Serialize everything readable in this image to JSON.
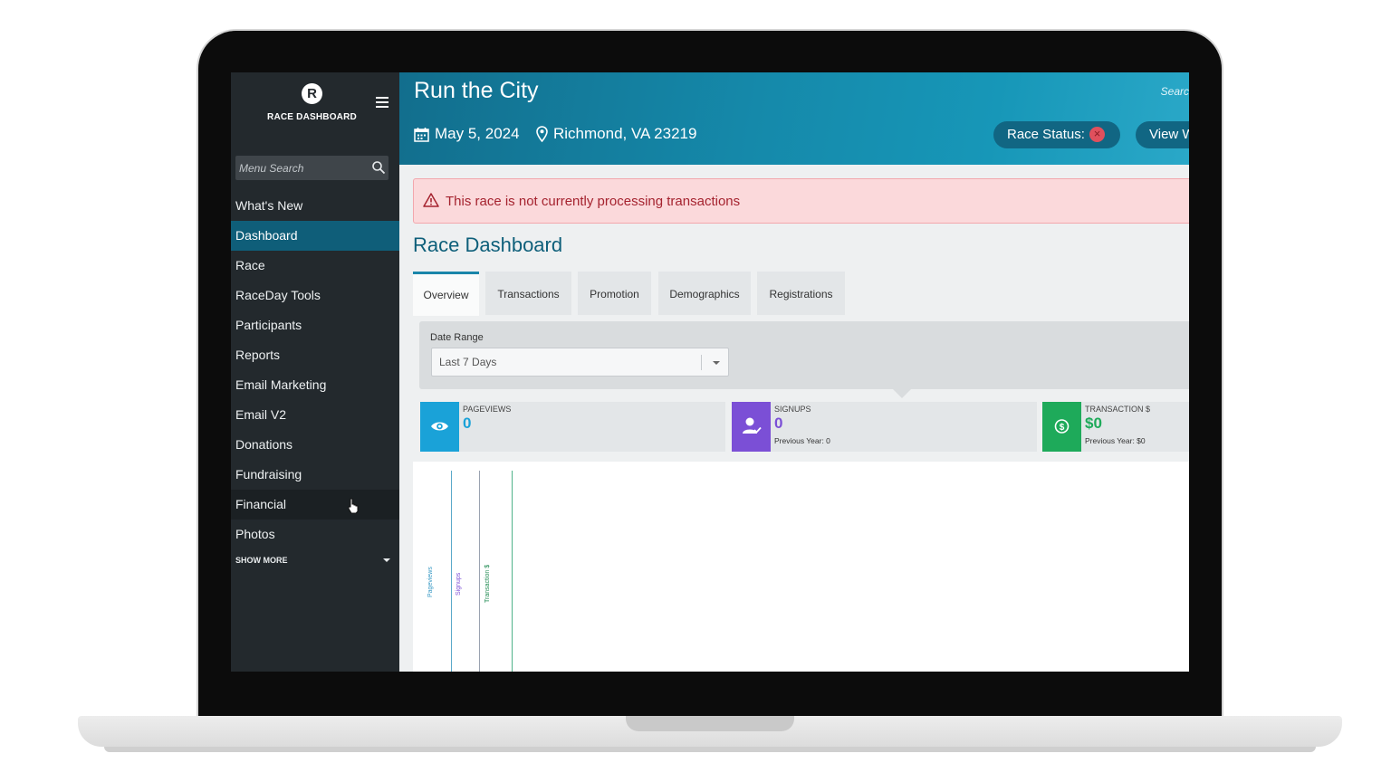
{
  "app": {
    "brand": "RACE DASHBOARD",
    "logo_letter": "R",
    "colors": {
      "accent": "#0f5e79",
      "sidebar": "#23292d",
      "header": "#1589aa",
      "alert_bg": "#fbd9db"
    }
  },
  "sidebar": {
    "search_placeholder": "Menu Search",
    "items": [
      {
        "label": "What's New"
      },
      {
        "label": "Dashboard",
        "active": true
      },
      {
        "label": "Race"
      },
      {
        "label": "RaceDay Tools"
      },
      {
        "label": "Participants"
      },
      {
        "label": "Reports"
      },
      {
        "label": "Email Marketing"
      },
      {
        "label": "Email V2"
      },
      {
        "label": "Donations"
      },
      {
        "label": "Fundraising"
      },
      {
        "label": "Financial",
        "hover": true
      },
      {
        "label": "Photos"
      }
    ],
    "show_more": "SHOW MORE"
  },
  "header": {
    "title": "Run the City",
    "search_hint": "Searc",
    "date": "May 5, 2024",
    "location": "Richmond, VA 23219",
    "race_status_label": "Race Status:",
    "view_label": "View W"
  },
  "alert": {
    "text": "This race is not currently processing transactions"
  },
  "main": {
    "title": "Race Dashboard",
    "tabs": [
      {
        "label": "Overview",
        "active": true
      },
      {
        "label": "Transactions"
      },
      {
        "label": "Promotion"
      },
      {
        "label": "Demographics"
      },
      {
        "label": "Registrations"
      }
    ],
    "date_range_label": "Date Range",
    "date_range_value": "Last 7 Days",
    "stats": [
      {
        "label": "PAGEVIEWS",
        "value": "0",
        "prev": "",
        "color": "#1aa2d8"
      },
      {
        "label": "SIGNUPS",
        "value": "0",
        "prev": "Previous Year: 0",
        "color": "#7b4fd6"
      },
      {
        "label": "TRANSACTION $",
        "value": "$0",
        "prev": "Previous Year: $0",
        "color": "#1eaa5a"
      }
    ],
    "chart_labels": [
      "Pageviews",
      "Signups",
      "Transaction $"
    ]
  }
}
